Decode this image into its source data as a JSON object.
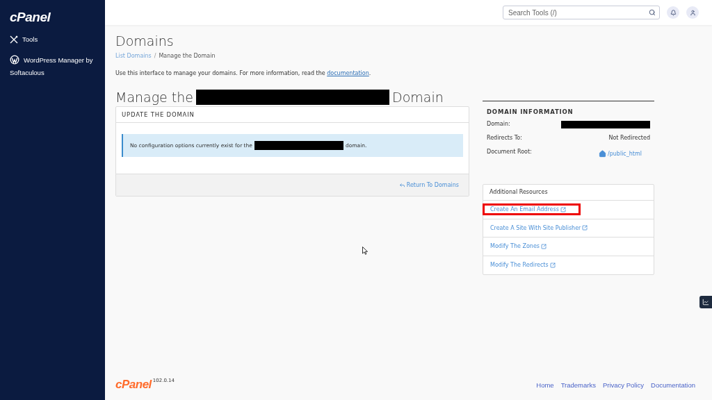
{
  "sidebar": {
    "logo": "cPanel",
    "items": [
      {
        "kind": "tools",
        "label": "Tools"
      },
      {
        "kind": "wordpress",
        "label": "WordPress Manager by Softaculous"
      }
    ]
  },
  "header": {
    "search": {
      "placeholder": "Search Tools (/)"
    }
  },
  "page": {
    "title": "Domains",
    "breadcrumb_separator": "/",
    "breadcrumb": [
      {
        "label": "List Domains",
        "link": true
      },
      {
        "label": "Manage the Domain",
        "link": false
      }
    ],
    "intro": "Use this interface to manage your domains. For more information, read the",
    "intro_link": "documentation",
    "intro_end": ".",
    "heading": {
      "before": "Manage the",
      "redacted": true,
      "after": "Domain"
    },
    "update_panel": {
      "title": "UPDATE THE DOMAIN",
      "notice_before": "No configuration options currently exist for the",
      "notice_redacted": true,
      "notice_after": "domain.",
      "return_link": "Return To Domains"
    },
    "domain_info": {
      "title": "DOMAIN INFORMATION",
      "rows": [
        {
          "label": "Domain:",
          "kind": "redacted"
        },
        {
          "label": "Redirects To:",
          "kind": "text",
          "value": "Not Redirected"
        },
        {
          "label": "Document Root:",
          "kind": "link",
          "value": "/public_html"
        }
      ]
    },
    "resources": {
      "title": "Additional Resources",
      "items": [
        {
          "label": "Create An Email Address",
          "highlighted": true
        },
        {
          "label": "Create A Site With Site Publisher",
          "highlighted": false
        },
        {
          "label": "Modify The Zones",
          "highlighted": false
        },
        {
          "label": "Modify The Redirects",
          "highlighted": false
        }
      ]
    }
  },
  "footer": {
    "logo": "cPanel",
    "version": "102.0.14",
    "links": [
      "Home",
      "Trademarks",
      "Privacy Policy",
      "Documentation"
    ]
  }
}
